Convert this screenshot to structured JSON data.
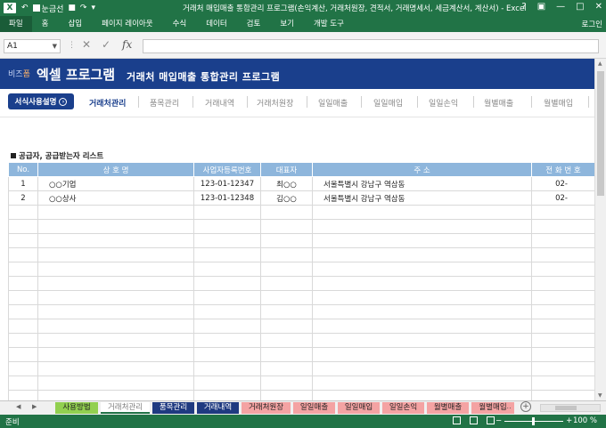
{
  "window": {
    "title": "거래처 매입매출 통합관리 프로그램(손익계산, 거래처원장, 견적서, 거래명세서, 세금계산서, 계산서) - Excel",
    "app_icon": "X",
    "autosave_label": "눈금선",
    "minimize": "—",
    "maximize": "□",
    "close": "✕"
  },
  "ribbon": {
    "tabs": [
      "파일",
      "홈",
      "삽입",
      "페이지 레이아웃",
      "수식",
      "데이터",
      "검토",
      "보기",
      "개발 도구"
    ],
    "login": "로그인"
  },
  "formula_bar": {
    "name_box": "A1",
    "formula": ""
  },
  "banner": {
    "logo_prefix": "비즈",
    "logo_suffix": "폼",
    "program_title": "엑셀 프로그램",
    "subtitle": "거래처 매입매출 통합관리 프로그램"
  },
  "menu": {
    "guide_button": "서식사용설명",
    "items": [
      "거래처관리",
      "품목관리",
      "거래내역",
      "거래처원장",
      "일일매출",
      "일일매입",
      "일일손익",
      "월별매출",
      "월별매입"
    ],
    "active_index": 0
  },
  "section": {
    "title": "공급자, 공급받는자 리스트"
  },
  "table": {
    "headers": [
      "No.",
      "상 호 명",
      "사업자등록번호",
      "대표자",
      "주 소",
      "전 화 번 호"
    ],
    "rows": [
      [
        "1",
        "○○기업",
        "123-01-12347",
        "최○○",
        "서울특별시 강남구 역삼동",
        "02-"
      ],
      [
        "2",
        "○○상사",
        "123-01-12348",
        "김○○",
        "서울특별시 강남구 역삼동",
        "02-"
      ]
    ],
    "empty_rows": 15
  },
  "sheet_tabs": [
    {
      "label": "사용방법",
      "bg": "#92d050",
      "fg": "#222222"
    },
    {
      "label": "거래처관리",
      "bg": "#ffffff",
      "fg": "#7f7f7f"
    },
    {
      "label": "품목관리",
      "bg": "#1f3a80",
      "fg": "#ffffff"
    },
    {
      "label": "거래내역",
      "bg": "#1f3a80",
      "fg": "#ffffff"
    },
    {
      "label": "거래처원장",
      "bg": "#f4a3a3",
      "fg": "#222222"
    },
    {
      "label": "일일매출",
      "bg": "#f4a3a3",
      "fg": "#222222"
    },
    {
      "label": "일일매입",
      "bg": "#f4a3a3",
      "fg": "#222222"
    },
    {
      "label": "일일손익",
      "bg": "#f4a3a3",
      "fg": "#222222"
    },
    {
      "label": "월별매출",
      "bg": "#f4a3a3",
      "fg": "#222222"
    },
    {
      "label": "월별매입",
      "bg": "#f4a3a3",
      "fg": "#222222"
    }
  ],
  "sheet_tabs_more": "...",
  "status": {
    "ready": "준비",
    "zoom": "100 %"
  },
  "colors": {
    "excel_green": "#217346",
    "banner_blue": "#1a3f8c",
    "header_blue": "#8eb6dc"
  }
}
